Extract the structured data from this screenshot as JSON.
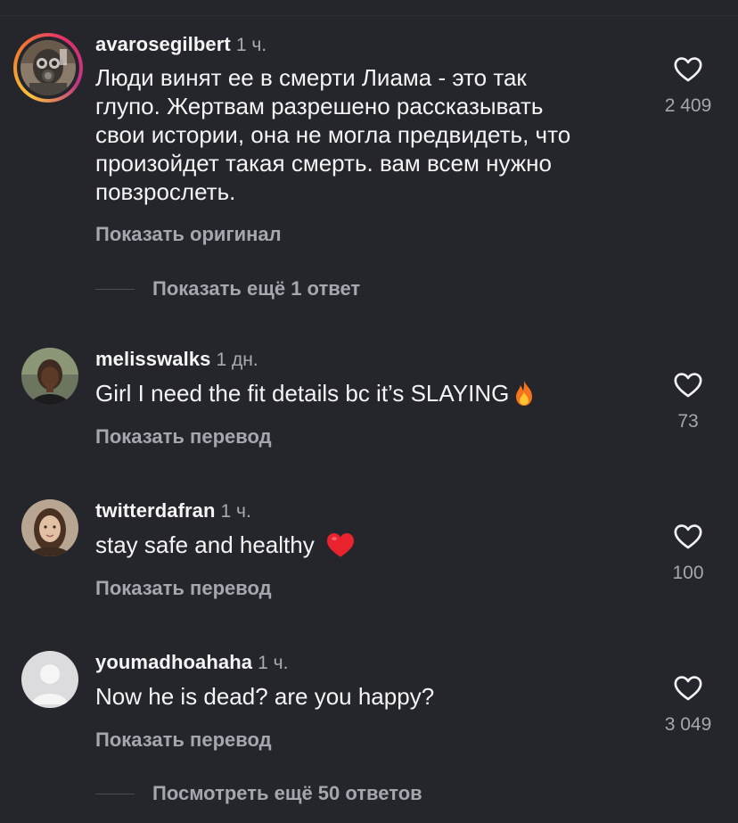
{
  "comments": [
    {
      "username": "avarosegilbert",
      "time": "1 ч.",
      "text_lines": [
        "Люди винят ее в смерти Лиама - это так",
        "глупо. Жертвам разрешено рассказывать",
        "свои истории, она не могла предвидеть, что",
        "произойдет такая смерть. вам всем нужно",
        "повзрослеть."
      ],
      "action": "Показать оригинал",
      "likes": "2 409",
      "replies": "Показать ещё 1 ответ",
      "avatar": "gas-mask-avatar"
    },
    {
      "username": "melisswalks",
      "time": "1 дн.",
      "text": "Girl I need the fit details bc it’s SLAYING",
      "emoji": "fire-emoji",
      "action": "Показать перевод",
      "likes": "73",
      "avatar": "photo-avatar"
    },
    {
      "username": "twitterdafran",
      "time": "1 ч.",
      "text": "stay safe and healthy",
      "emoji": "red-heart-emoji",
      "action": "Показать перевод",
      "likes": "100",
      "avatar": "photo-avatar"
    },
    {
      "username": "youmadhoahaha",
      "time": "1 ч.",
      "text": "Now he is dead? are you happy?",
      "action": "Показать перевод",
      "likes": "3 049",
      "replies": "Посмотреть ещё 50 ответов",
      "avatar": "default-avatar"
    }
  ],
  "colors": {
    "background": "#25262b",
    "primary_text": "#f4f4f6",
    "secondary_text": "#a5a7ae",
    "story_ring": [
      "#f9c13c",
      "#e1306c",
      "#c13584"
    ]
  }
}
